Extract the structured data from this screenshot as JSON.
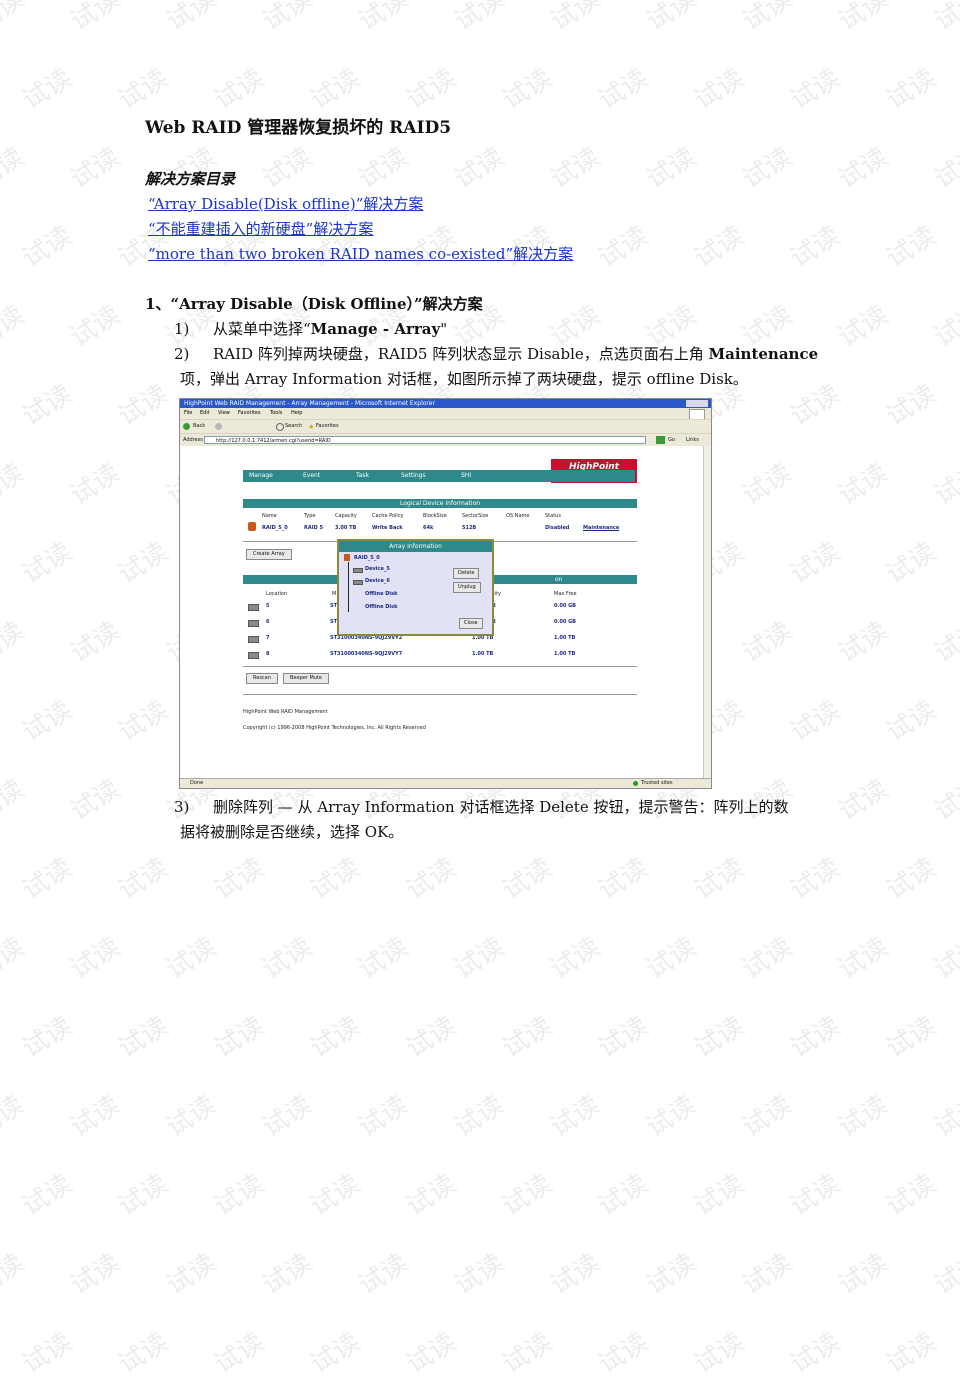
{
  "watermark": {
    "text": "试读"
  },
  "title": "Web RAID 管理器恢复损坏的 RAID5",
  "toc": {
    "heading": "解决方案目录",
    "links": [
      "“Array Disable(Disk offline)”解决方案",
      "“不能重建插入的新硬盘”解决方案",
      "“more than two broken RAID names co-existed”解决方案"
    ]
  },
  "section1": {
    "heading": "1、“Array Disable（Disk Offline）”解决方案",
    "step1": {
      "num": "1)",
      "prefix": "从菜单中选择“",
      "bold": "Manage - Array",
      "suffix": "\""
    },
    "step2": {
      "num": "2)",
      "line1_text": "RAID 阵列掉两块硬盘，RAID5  阵列状态显示 Disable，点选页面右上角 ",
      "line1_bold": "Maintenance",
      "line2": "项，弹出 Array Information 对话框，如图所示掉了两块硬盘，提示 offline Disk。"
    },
    "step3": {
      "num": "3)",
      "line1": "删除阵列  —  从 Array  Information 对话框选择 Delete 按钮，提示警告：阵列上的数",
      "line2": "据将被删除是否继续，选择 OK。"
    }
  },
  "screenshot": {
    "window_title": "HighPoint Web RAID Management - Array Management - Microsoft Internet Explorer",
    "menu": [
      "File",
      "Edit",
      "View",
      "Favorites",
      "Tools",
      "Help"
    ],
    "toolbar": [
      "Back",
      "Search",
      "Favorites"
    ],
    "address_label": "Address",
    "address": "http://127.0.0.1:7412/armen.cgi?userid=RAID",
    "go": "Go",
    "links": "Links",
    "nav": [
      "Manage",
      "Event",
      "Task",
      "Settings",
      "SHI"
    ],
    "logo": "HighPoint",
    "logo_sub": "Technologies, Inc.",
    "logical_header": "Logical Device Information",
    "logical_columns": [
      "Name",
      "Type",
      "Capacity",
      "Cache Policy",
      "BlockSize",
      "SectorSize",
      "OS Name",
      "Status"
    ],
    "logical_row": [
      "RAID_5_0",
      "RAID 5",
      "3.00 TB",
      "Write Back",
      "64k",
      "512B",
      "",
      "Disabled"
    ],
    "maintenance": "Maintenance",
    "create_array": "Create Array",
    "physical_header_tail": "on",
    "physical_columns": {
      "location": "Location",
      "model": "M",
      "capacity": "city",
      "maxfree": "Max Free"
    },
    "physical_rows": [
      {
        "loc": "5",
        "model": "ST",
        "cap": "B",
        "free": "0.00 GB"
      },
      {
        "loc": "6",
        "model": "ST",
        "cap": "B",
        "free": "0.00 GB"
      },
      {
        "loc": "7",
        "model": "ST31000340NS-9QJ29VY2",
        "cap": "1.00 TB",
        "free": "1.00 TB"
      },
      {
        "loc": "8",
        "model": "ST31000340NS-9QJ29VY7",
        "cap": "1.00 TB",
        "free": "1.00 TB"
      }
    ],
    "rescan": "Rescan",
    "beeper": "Beeper Mute",
    "footer1": "HighPoint Web RAID Management",
    "footer2": "Copyright (c) 1996-2008 HighPoint Technologies, Inc. All Rights Reserved",
    "dialog": {
      "title": "Array Information",
      "tree": [
        "RAID_5_0",
        "Device_5",
        "Device_6",
        "Offline Disk",
        "Offline Disk"
      ],
      "delete": "Delete",
      "unplug": "Unplug",
      "close": "Close"
    },
    "status_left": "Done",
    "status_right": "Trusted sites"
  }
}
